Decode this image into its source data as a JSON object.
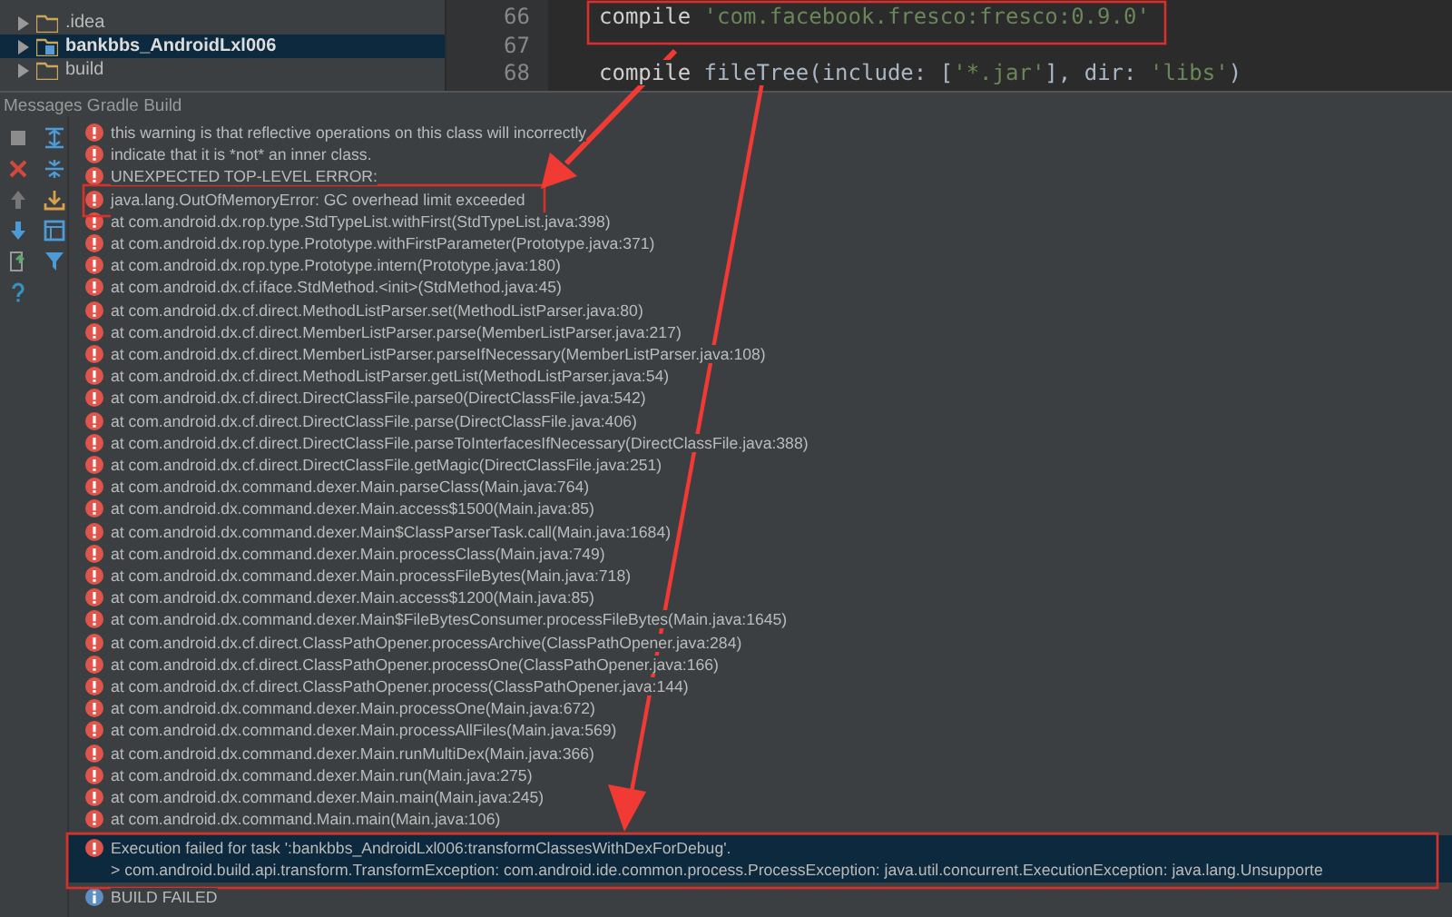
{
  "project_tree": {
    "items": [
      {
        "label": ".idea",
        "kind": "folder",
        "selected": false
      },
      {
        "label": "bankbbs_AndroidLxl006",
        "kind": "module",
        "selected": true
      },
      {
        "label": "build",
        "kind": "folder",
        "selected": false
      }
    ]
  },
  "editor": {
    "lines": [
      {
        "number": "66",
        "tokens": [
          {
            "kind": "keyword",
            "text": "compile "
          },
          {
            "kind": "string",
            "text": "'com.facebook.fresco:fresco:0.9.0'"
          }
        ]
      },
      {
        "number": "67"
      },
      {
        "number": "68",
        "tokens": [
          {
            "kind": "keyword",
            "text": "compile "
          },
          {
            "kind": "plain",
            "text": "fileTree("
          },
          {
            "kind": "param",
            "text": "include: "
          },
          {
            "kind": "plain",
            "text": "["
          },
          {
            "kind": "string",
            "text": "'*.jar'"
          },
          {
            "kind": "plain",
            "text": "], "
          },
          {
            "kind": "param",
            "text": "dir: "
          },
          {
            "kind": "string",
            "text": "'libs'"
          },
          {
            "kind": "plain",
            "text": ")"
          }
        ]
      }
    ]
  },
  "messages": {
    "title": "Messages Gradle Build",
    "items": [
      {
        "kind": "error",
        "selected": false,
        "lines": [
          "this warning is that reflective operations on this class will incorrectly"
        ]
      },
      {
        "kind": "error",
        "selected": false,
        "lines": [
          "indicate that it is *not* an inner class."
        ]
      },
      {
        "kind": "error",
        "selected": false,
        "lines": [
          "UNEXPECTED TOP-LEVEL ERROR:"
        ]
      },
      {
        "kind": "error",
        "selected": false,
        "lines": [
          "java.lang.OutOfMemoryError: GC overhead limit exceeded"
        ]
      },
      {
        "kind": "error",
        "selected": false,
        "lines": [
          "at com.android.dx.rop.type.StdTypeList.withFirst(StdTypeList.java:398)"
        ]
      },
      {
        "kind": "error",
        "selected": false,
        "lines": [
          "at com.android.dx.rop.type.Prototype.withFirstParameter(Prototype.java:371)"
        ]
      },
      {
        "kind": "error",
        "selected": false,
        "lines": [
          "at com.android.dx.rop.type.Prototype.intern(Prototype.java:180)"
        ]
      },
      {
        "kind": "error",
        "selected": false,
        "lines": [
          "at com.android.dx.cf.iface.StdMethod.<init>(StdMethod.java:45)"
        ]
      },
      {
        "kind": "error",
        "selected": false,
        "lines": [
          "at com.android.dx.cf.direct.MethodListParser.set(MethodListParser.java:80)"
        ]
      },
      {
        "kind": "error",
        "selected": false,
        "lines": [
          "at com.android.dx.cf.direct.MemberListParser.parse(MemberListParser.java:217)"
        ]
      },
      {
        "kind": "error",
        "selected": false,
        "lines": [
          "at com.android.dx.cf.direct.MemberListParser.parseIfNecessary(MemberListParser.java:108)"
        ]
      },
      {
        "kind": "error",
        "selected": false,
        "lines": [
          "at com.android.dx.cf.direct.MethodListParser.getList(MethodListParser.java:54)"
        ]
      },
      {
        "kind": "error",
        "selected": false,
        "lines": [
          "at com.android.dx.cf.direct.DirectClassFile.parse0(DirectClassFile.java:542)"
        ]
      },
      {
        "kind": "error",
        "selected": false,
        "lines": [
          "at com.android.dx.cf.direct.DirectClassFile.parse(DirectClassFile.java:406)"
        ]
      },
      {
        "kind": "error",
        "selected": false,
        "lines": [
          "at com.android.dx.cf.direct.DirectClassFile.parseToInterfacesIfNecessary(DirectClassFile.java:388)"
        ]
      },
      {
        "kind": "error",
        "selected": false,
        "lines": [
          "at com.android.dx.cf.direct.DirectClassFile.getMagic(DirectClassFile.java:251)"
        ]
      },
      {
        "kind": "error",
        "selected": false,
        "lines": [
          "at com.android.dx.command.dexer.Main.parseClass(Main.java:764)"
        ]
      },
      {
        "kind": "error",
        "selected": false,
        "lines": [
          "at com.android.dx.command.dexer.Main.access$1500(Main.java:85)"
        ]
      },
      {
        "kind": "error",
        "selected": false,
        "lines": [
          "at com.android.dx.command.dexer.Main$ClassParserTask.call(Main.java:1684)"
        ]
      },
      {
        "kind": "error",
        "selected": false,
        "lines": [
          "at com.android.dx.command.dexer.Main.processClass(Main.java:749)"
        ]
      },
      {
        "kind": "error",
        "selected": false,
        "lines": [
          "at com.android.dx.command.dexer.Main.processFileBytes(Main.java:718)"
        ]
      },
      {
        "kind": "error",
        "selected": false,
        "lines": [
          "at com.android.dx.command.dexer.Main.access$1200(Main.java:85)"
        ]
      },
      {
        "kind": "error",
        "selected": false,
        "lines": [
          "at com.android.dx.command.dexer.Main$FileBytesConsumer.processFileBytes(Main.java:1645)"
        ]
      },
      {
        "kind": "error",
        "selected": false,
        "lines": [
          "at com.android.dx.cf.direct.ClassPathOpener.processArchive(ClassPathOpener.java:284)"
        ]
      },
      {
        "kind": "error",
        "selected": false,
        "lines": [
          "at com.android.dx.cf.direct.ClassPathOpener.processOne(ClassPathOpener.java:166)"
        ]
      },
      {
        "kind": "error",
        "selected": false,
        "lines": [
          "at com.android.dx.cf.direct.ClassPathOpener.process(ClassPathOpener.java:144)"
        ]
      },
      {
        "kind": "error",
        "selected": false,
        "lines": [
          "at com.android.dx.command.dexer.Main.processOne(Main.java:672)"
        ]
      },
      {
        "kind": "error",
        "selected": false,
        "lines": [
          "at com.android.dx.command.dexer.Main.processAllFiles(Main.java:569)"
        ]
      },
      {
        "kind": "error",
        "selected": false,
        "lines": [
          "at com.android.dx.command.dexer.Main.runMultiDex(Main.java:366)"
        ]
      },
      {
        "kind": "error",
        "selected": false,
        "lines": [
          "at com.android.dx.command.dexer.Main.run(Main.java:275)"
        ]
      },
      {
        "kind": "error",
        "selected": false,
        "lines": [
          "at com.android.dx.command.dexer.Main.main(Main.java:245)"
        ]
      },
      {
        "kind": "error",
        "selected": false,
        "lines": [
          "at com.android.dx.command.Main.main(Main.java:106)"
        ]
      },
      {
        "kind": "error",
        "selected": true,
        "lines": [
          "Execution failed for task ':bankbbs_AndroidLxl006:transformClassesWithDexForDebug'.",
          "> com.android.build.api.transform.TransformException: com.android.ide.common.process.ProcessException: java.util.concurrent.ExecutionException: java.lang.Unsupporte"
        ]
      },
      {
        "kind": "info",
        "selected": false,
        "lines": [
          "BUILD FAILED"
        ]
      }
    ]
  }
}
